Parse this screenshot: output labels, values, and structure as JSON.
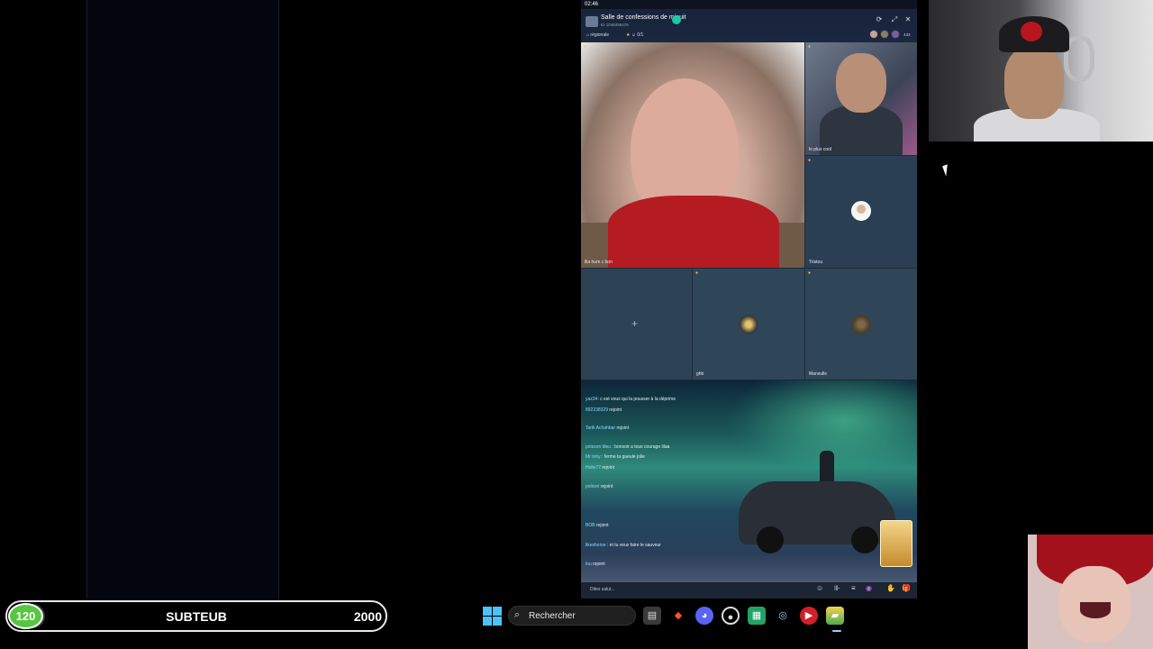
{
  "status_bar": {
    "time": "02:46"
  },
  "room": {
    "title": "Salle de confessions de minuit",
    "subtitle": "ID 1046456476",
    "region": "régionale",
    "stars": "0/1",
    "viewers": "433"
  },
  "tiles": {
    "main_name": "llia hum c bon",
    "man_name": "le plus cool",
    "tristou_name": "Tristou",
    "ghb_name": "ghb",
    "mansule_name": "Mansulle",
    "plus": "+"
  },
  "chat": [
    {
      "user": "yaz34",
      "text": ": c est vous qui la pousser à la déprime"
    },
    {
      "user": "892238329",
      "text": " rejoint"
    },
    {
      "user": "Tarik Achahbar",
      "text": " rejoint"
    },
    {
      "user": "poisson bleu",
      "text": " : bonsoir a tous  courage lilaa"
    },
    {
      "user": "Mr tony",
      "text": " : ferme ta gueule jolie"
    },
    {
      "user": "Hollo77",
      "text": " rejoint"
    },
    {
      "user": "policiel",
      "text": " rejoint"
    },
    {
      "user": "BOB",
      "text": " rejoint"
    },
    {
      "user": "likeshorse",
      "text": " : et tu veux faire le sauveur"
    },
    {
      "user": "lou",
      "text": " rejoint"
    }
  ],
  "input": {
    "placeholder": "Dites salut..."
  },
  "sub_goal": {
    "current": "120",
    "label": "SUBTEUB",
    "target": "2000",
    "progress": 0.06
  },
  "taskbar": {
    "search_text": "Rechercher",
    "apps": [
      "file-explorer-icon",
      "brave-icon",
      "discord-icon",
      "obs-icon",
      "spreadsheet-icon",
      "steam-icon",
      "youtube-icon",
      "app-icon"
    ]
  },
  "colors": {
    "goal_green": "#57c642",
    "live_teal": "#1ec9a6",
    "windows_blue": "#4cc2ff"
  }
}
